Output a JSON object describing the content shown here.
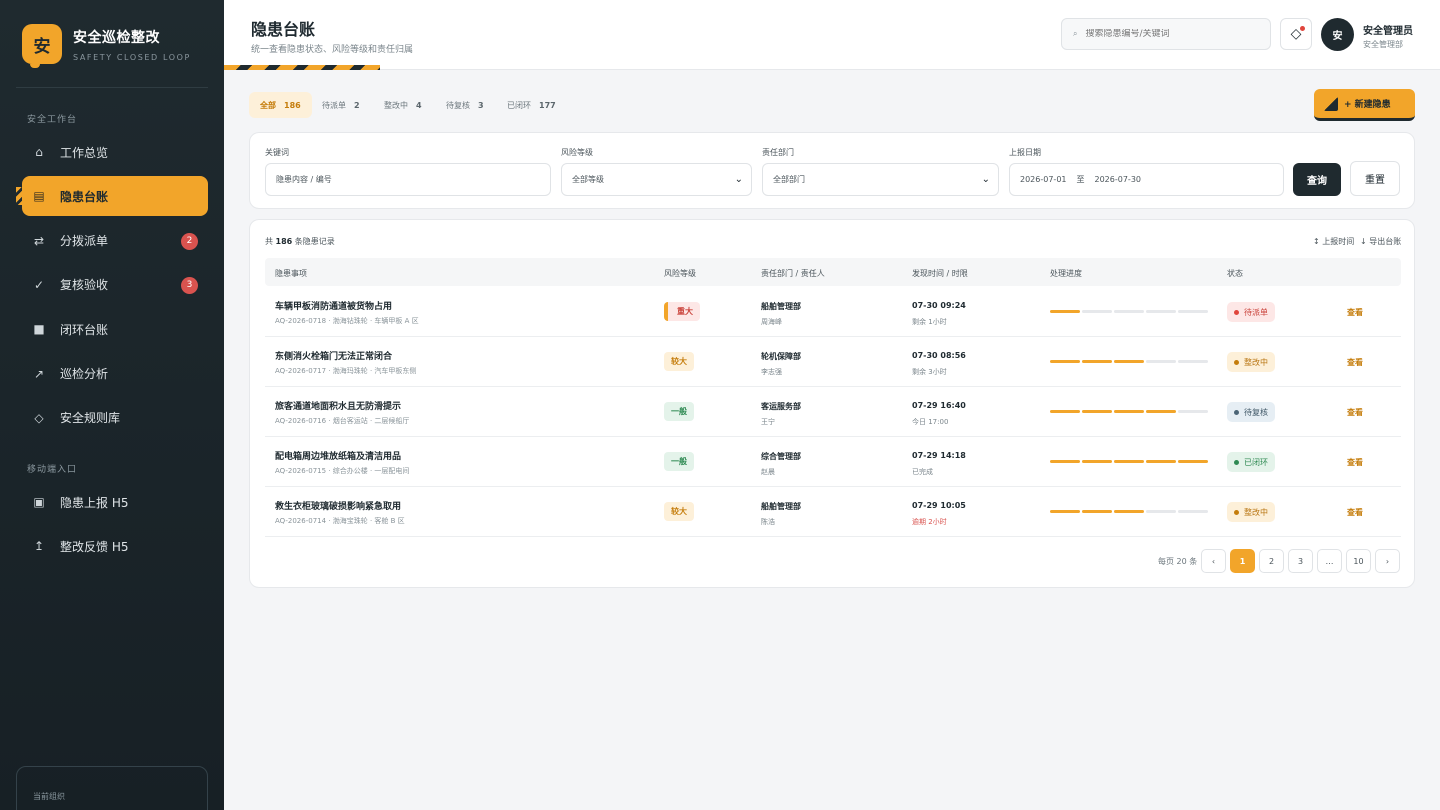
{
  "brand": {
    "logo_char": "安",
    "title": "安全巡检整改",
    "subtitle": "SAFETY CLOSED LOOP"
  },
  "sidebar": {
    "section_main": "安全工作台",
    "items": [
      {
        "label": "工作总览",
        "icon": "⌂",
        "icon_name": "home-icon"
      },
      {
        "label": "隐患台账",
        "icon": "▤",
        "icon_name": "list-icon",
        "active": true
      },
      {
        "label": "分拨派单",
        "icon": "⇄",
        "icon_name": "dispatch-icon",
        "badge": "2"
      },
      {
        "label": "复核验收",
        "icon": "✓",
        "icon_name": "check-icon",
        "badge": "3"
      },
      {
        "label": "闭环台账",
        "icon": "■",
        "icon_name": "ledger-icon"
      },
      {
        "label": "巡检分析",
        "icon": "↗",
        "icon_name": "trend-icon"
      },
      {
        "label": "安全规则库",
        "icon": "◇",
        "icon_name": "rules-icon"
      }
    ],
    "section_mobile": "移动端入口",
    "mobile_items": [
      {
        "label": "隐患上报 H5",
        "icon": "▣",
        "icon_name": "report-icon"
      },
      {
        "label": "整改反馈 H5",
        "icon": "↥",
        "icon_name": "upload-icon"
      }
    ],
    "org_label": "当前组织"
  },
  "header": {
    "title": "隐患台账",
    "subtitle": "统一查看隐患状态、风险等级和责任归属",
    "search_placeholder": "搜索隐患编号/关键词",
    "search_icon": "⌕",
    "bell_icon": "◇",
    "user": {
      "avatar": "安",
      "name": "安全管理员",
      "role": "安全管理部"
    }
  },
  "tabs": [
    {
      "label": "全部",
      "count": "186",
      "active": true
    },
    {
      "label": "待派单",
      "count": "2"
    },
    {
      "label": "整改中",
      "count": "4"
    },
    {
      "label": "待复核",
      "count": "3"
    },
    {
      "label": "已闭环",
      "count": "177"
    }
  ],
  "new_button": "+ 新建隐患",
  "filters": {
    "keyword": {
      "label": "关键词",
      "placeholder": "隐患内容 / 编号"
    },
    "risk": {
      "label": "风险等级",
      "value": "全部等级"
    },
    "dept": {
      "label": "责任部门",
      "value": "全部部门"
    },
    "date": {
      "label": "上报日期",
      "start": "2026-07-01",
      "sep": "至",
      "end": "2026-07-30"
    },
    "query": "查询",
    "reset": "重置"
  },
  "table": {
    "total_prefix": "共",
    "total_count": "186",
    "total_suffix": "条隐患记录",
    "sort_label": "↕ 上报时间",
    "export_label": "↓ 导出台账",
    "columns": [
      "隐患事项",
      "风险等级",
      "责任部门 / 责任人",
      "发现时间 / 时限",
      "处理进度",
      "状态"
    ],
    "rows": [
      {
        "title": "车辆甲板消防通道被货物占用",
        "sub": "AQ-2026-0718 · 渤海钻珠轮 · 车辆甲板 A 区",
        "risk": "重大",
        "risk_class": "major",
        "dept": "船舶管理部",
        "owner": "周海峰",
        "found": "07-30 09:24",
        "remain": "剩余 1小时",
        "overdue": false,
        "progress": 1,
        "status": "待派单",
        "status_class": "pending",
        "action": "查看"
      },
      {
        "title": "东侧消火栓箱门无法正常闭合",
        "sub": "AQ-2026-0717 · 渤海玛珠轮 · 汽车甲板东侧",
        "risk": "较大",
        "risk_class": "big",
        "dept": "轮机保障部",
        "owner": "李志强",
        "found": "07-30 08:56",
        "remain": "剩余 3小时",
        "overdue": false,
        "progress": 3,
        "status": "整改中",
        "status_class": "fixing",
        "action": "查看"
      },
      {
        "title": "旅客通道地面积水且无防滑提示",
        "sub": "AQ-2026-0716 · 烟台客运站 · 二层候船厅",
        "risk": "一般",
        "risk_class": "normal",
        "dept": "客运服务部",
        "owner": "王宁",
        "found": "07-29 16:40",
        "remain": "今日 17:00",
        "overdue": false,
        "progress": 4,
        "status": "待复核",
        "status_class": "review",
        "action": "查看"
      },
      {
        "title": "配电箱周边堆放纸箱及清洁用品",
        "sub": "AQ-2026-0715 · 综合办公楼 · 一层配电间",
        "risk": "一般",
        "risk_class": "normal",
        "dept": "综合管理部",
        "owner": "赵晨",
        "found": "07-29 14:18",
        "remain": "已完成",
        "overdue": false,
        "progress": 5,
        "status": "已闭环",
        "status_class": "closed",
        "action": "查看"
      },
      {
        "title": "救生衣柜玻璃破损影响紧急取用",
        "sub": "AQ-2026-0714 · 渤海宝珠轮 · 客舱 B 区",
        "risk": "较大",
        "risk_class": "big",
        "dept": "船舶管理部",
        "owner": "陈浩",
        "found": "07-29 10:05",
        "remain": "逾期 2小时",
        "overdue": true,
        "progress": 3,
        "status": "整改中",
        "status_class": "fixing",
        "action": "查看"
      }
    ]
  },
  "pager": {
    "per_page": "每页 20 条",
    "prev": "‹",
    "pages": [
      "1",
      "2",
      "3",
      "…",
      "10"
    ],
    "next": "›",
    "current": "1"
  },
  "colors": {
    "accent": "#f2a52a",
    "sidebar_bg": "#1f2a2f",
    "danger": "#d9534f"
  }
}
